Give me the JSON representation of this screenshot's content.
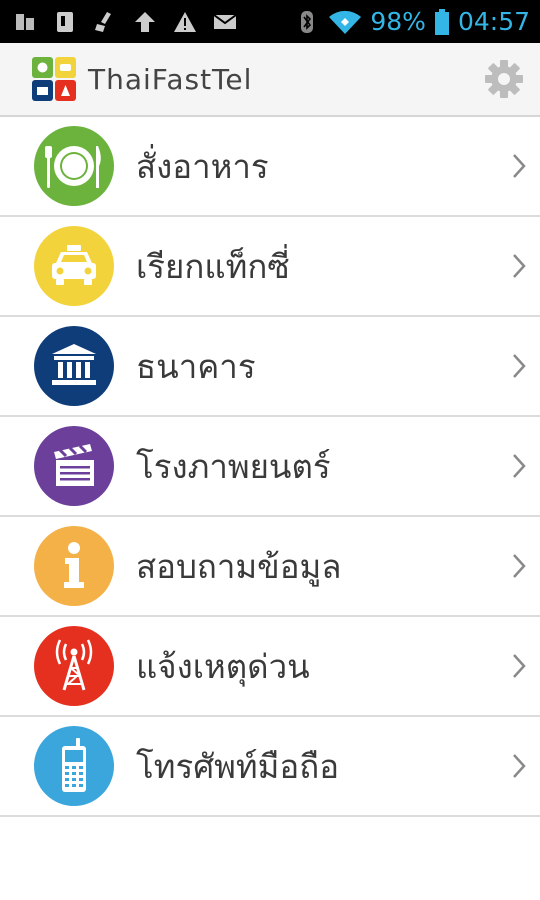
{
  "status_bar": {
    "battery": "98%",
    "time": "04:57",
    "icons": [
      "sim-card-icon",
      "phone-icon",
      "broom-icon",
      "upload-icon",
      "warning-icon",
      "mail-icon",
      "bluetooth-icon",
      "wifi-icon",
      "battery-icon"
    ]
  },
  "app_bar": {
    "title": "ThaiFastTel",
    "icon": "app-logo-icon",
    "settings_icon": "gear-icon"
  },
  "menu": [
    {
      "label": "สั่งอาหาร",
      "icon": "plate-icon",
      "color": "#6cb33e"
    },
    {
      "label": "เรียกแท็กซี่",
      "icon": "taxi-icon",
      "color": "#f3d33c"
    },
    {
      "label": "ธนาคาร",
      "icon": "bank-icon",
      "color": "#0f3d7a"
    },
    {
      "label": "โรงภาพยนตร์",
      "icon": "clapperboard-icon",
      "color": "#6b3f9a"
    },
    {
      "label": "สอบถามข้อมูล",
      "icon": "info-icon",
      "color": "#f3b148"
    },
    {
      "label": "แจ้งเหตุด่วน",
      "icon": "radio-tower-icon",
      "color": "#e53020"
    },
    {
      "label": "โทรศัพท์มือถือ",
      "icon": "mobile-phone-icon",
      "color": "#3aa6dc"
    }
  ]
}
